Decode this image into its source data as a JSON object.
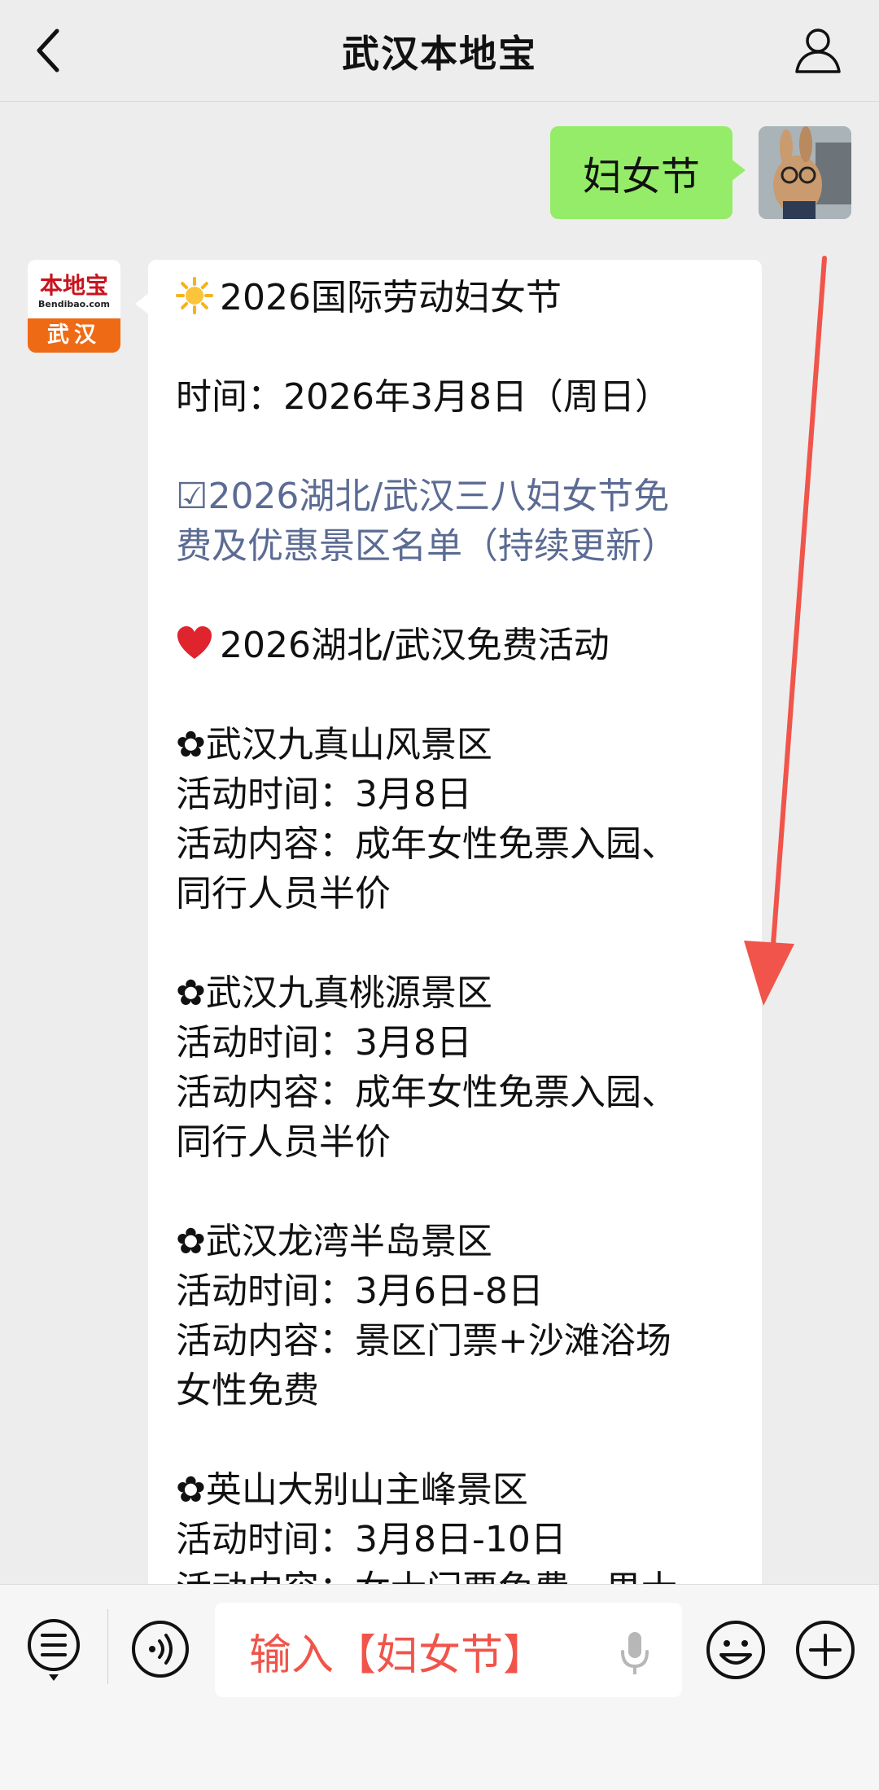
{
  "header": {
    "title": "武汉本地宝"
  },
  "user_message": {
    "text": "妇女节"
  },
  "bot": {
    "logo": {
      "name": "本地宝",
      "domain": "Bendibao.com",
      "city": "武汉"
    },
    "lines": [
      {
        "emoji": "sun",
        "text": "2026国际劳动妇女节"
      },
      {
        "text": ""
      },
      {
        "text": "时间：2026年3月8日（周日）"
      },
      {
        "text": ""
      },
      {
        "text": "☑2026湖北/武汉三八妇女节免",
        "link": true
      },
      {
        "text": "费及优惠景区名单（持续更新）",
        "link": true
      },
      {
        "text": ""
      },
      {
        "emoji": "heart",
        "text": "2026湖北/武汉免费活动"
      },
      {
        "text": ""
      },
      {
        "text": "✿武汉九真山风景区"
      },
      {
        "text": "活动时间：3月8日"
      },
      {
        "text": "活动内容：成年女性免票入园、"
      },
      {
        "text": "同行人员半价"
      },
      {
        "text": ""
      },
      {
        "text": "✿武汉九真桃源景区"
      },
      {
        "text": "活动时间：3月8日"
      },
      {
        "text": "活动内容：成年女性免票入园、"
      },
      {
        "text": "同行人员半价"
      },
      {
        "text": ""
      },
      {
        "text": "✿武汉龙湾半岛景区"
      },
      {
        "text": "活动时间：3月6日-8日"
      },
      {
        "text": "活动内容：景区门票+沙滩浴场"
      },
      {
        "text": "女性免费"
      },
      {
        "text": ""
      },
      {
        "text": "✿英山大别山主峰景区"
      },
      {
        "text": "活动时间：3月8日-10日"
      },
      {
        "text": "活动内容：女士门票免费，男士"
      }
    ]
  },
  "input": {
    "text": "输入【妇女节】"
  },
  "colors": {
    "user_bubble": "#95ec69",
    "link": "#5b6b93",
    "arrow": "#f0544a",
    "input_text": "#f0544a"
  },
  "icons": [
    "back-arrow-icon",
    "person-icon",
    "menu-list-icon",
    "voice-icon",
    "mic-icon",
    "emoji-icon",
    "plus-icon",
    "sun-icon",
    "heart-icon"
  ]
}
